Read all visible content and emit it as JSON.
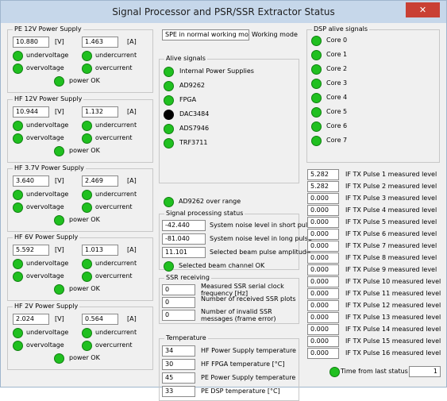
{
  "window": {
    "title": "Signal Processor and PSR/SSR Extractor Status",
    "close_label": "✕"
  },
  "power_supplies": [
    {
      "title": "PE 12V Power Supply",
      "voltage": "10.880",
      "current": "1.463"
    },
    {
      "title": "HF 12V Power Supply",
      "voltage": "10.944",
      "current": "1.132"
    },
    {
      "title": "HF 3.7V Power Supply",
      "voltage": "3.640",
      "current": "2.469"
    },
    {
      "title": "HF 6V Power Supply",
      "voltage": "5.592",
      "current": "1.013"
    },
    {
      "title": "HF 2V Power Supply",
      "voltage": "2.024",
      "current": "0.564"
    }
  ],
  "ps_labels": {
    "voltage_unit": "[V]",
    "current_unit": "[A]",
    "undervoltage": "undervoltage",
    "undercurrent": "undercurrent",
    "overvoltage": "overvoltage",
    "overcurrent": "overcurrent",
    "power_ok": "power OK"
  },
  "mode": {
    "value": "SPE in normal working mode",
    "label": "Working mode"
  },
  "alive": {
    "title": "Alive signals",
    "items": [
      {
        "label": "Internal Power Supplies",
        "status": "ok"
      },
      {
        "label": "AD9262",
        "status": "ok"
      },
      {
        "label": "FPGA",
        "status": "ok"
      },
      {
        "label": "DAC3484",
        "status": "off"
      },
      {
        "label": "ADS7946",
        "status": "ok"
      },
      {
        "label": "TRF3711",
        "status": "ok"
      }
    ]
  },
  "ad9262_over_range": "AD9262 over range",
  "signal_processing": {
    "title": "Signal processing status",
    "rows": [
      {
        "value": "-42.440",
        "label": "System noise level in short pulse"
      },
      {
        "value": "-81.040",
        "label": "System noise level in long pulse"
      },
      {
        "value": "11.101",
        "label": "Selected beam pulse amplitude"
      }
    ],
    "selected_beam_ok": "Selected beam channel OK"
  },
  "ssr": {
    "title": "SSR receiving",
    "rows": [
      {
        "value": "0",
        "label": "Measured SSR serial clock frequency [Hz]"
      },
      {
        "value": "0",
        "label": "Number of received SSR plots"
      },
      {
        "value": "0",
        "label": "Number of invalid SSR messages (frame error)"
      }
    ]
  },
  "temperature": {
    "title": "Temperature",
    "rows": [
      {
        "value": "34",
        "label": "HF Power Supply temperature"
      },
      {
        "value": "30",
        "label": "HF FPGA temperature [°C]"
      },
      {
        "value": "45",
        "label": "PE Power Supply temperature"
      },
      {
        "value": "33",
        "label": "PE DSP temperature [°C]"
      }
    ]
  },
  "dsp": {
    "title": "DSP alive signals",
    "cores": [
      "Core 0",
      "Core 1",
      "Core 2",
      "Core 3",
      "Core 4",
      "Core 5",
      "Core 6",
      "Core 7"
    ]
  },
  "if_tx": [
    {
      "value": "5.282",
      "label": "IF TX Pulse  1 measured level"
    },
    {
      "value": "5.282",
      "label": "IF TX Pulse  2 measured level"
    },
    {
      "value": "0.000",
      "label": "IF TX Pulse  3 measured level"
    },
    {
      "value": "0.000",
      "label": "IF TX Pulse  4 measured level"
    },
    {
      "value": "0.000",
      "label": "IF TX Pulse  5 measured level"
    },
    {
      "value": "0.000",
      "label": "IF TX Pulse  6 measured level"
    },
    {
      "value": "0.000",
      "label": "IF TX Pulse  7 measured level"
    },
    {
      "value": "0.000",
      "label": "IF TX Pulse  8 measured level"
    },
    {
      "value": "0.000",
      "label": "IF TX Pulse  9 measured level"
    },
    {
      "value": "0.000",
      "label": "IF TX Pulse 10 measured level"
    },
    {
      "value": "0.000",
      "label": "IF TX Pulse 11 measured level"
    },
    {
      "value": "0.000",
      "label": "IF TX Pulse 12 measured level"
    },
    {
      "value": "0.000",
      "label": "IF TX Pulse 13 measured level"
    },
    {
      "value": "0.000",
      "label": "IF TX Pulse 14 measured level"
    },
    {
      "value": "0.000",
      "label": "IF TX Pulse 15 measured level"
    },
    {
      "value": "0.000",
      "label": "IF TX Pulse 16 measured level"
    }
  ],
  "status": {
    "label": "Time from last status",
    "value": "1"
  },
  "colors": {
    "led_ok": "#20c020",
    "led_off": "#000000",
    "title_bar": "#c6d7ea",
    "close_button": "#c94034"
  }
}
